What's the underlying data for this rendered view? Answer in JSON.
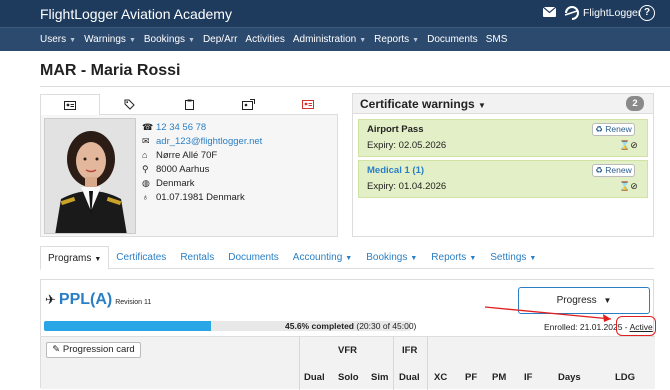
{
  "topbar": {
    "title": "FlightLogger Aviation Academy",
    "logo_text": "FlightLogger",
    "help_glyph": "?"
  },
  "nav": [
    {
      "label": "Users",
      "dropdown": true
    },
    {
      "label": "Warnings",
      "dropdown": true
    },
    {
      "label": "Bookings",
      "dropdown": true
    },
    {
      "label": "Dep/Arr",
      "dropdown": false
    },
    {
      "label": "Activities",
      "dropdown": false
    },
    {
      "label": "Administration",
      "dropdown": true
    },
    {
      "label": "Reports",
      "dropdown": true
    },
    {
      "label": "Documents",
      "dropdown": false
    },
    {
      "label": "SMS",
      "dropdown": false
    }
  ],
  "user": {
    "title": "MAR - Maria Rossi",
    "phone": "12 34 56 78",
    "email": "adr_123@flightlogger.net",
    "street": "Nørre Allé 70F",
    "city": "8000 Aarhus",
    "country": "Denmark",
    "birth": "01.07.1981 Denmark"
  },
  "profile_tabs": [
    "id-card-icon",
    "tags-icon",
    "clipboard-icon",
    "id-badge-icon",
    "red-id-card-icon"
  ],
  "cert_warnings": {
    "title": "Certificate warnings",
    "count": "2",
    "items": [
      {
        "name": "Airport Pass",
        "expiry": "Expiry: 02.05.2026",
        "renew": "Renew",
        "link": false
      },
      {
        "name": "Medical 1 (1)",
        "expiry": "Expiry: 01.04.2026",
        "renew": "Renew",
        "link": true
      }
    ]
  },
  "main_tabs": [
    {
      "label": "Programs",
      "dropdown": true,
      "active": true
    },
    {
      "label": "Certificates",
      "dropdown": false,
      "active": false
    },
    {
      "label": "Rentals",
      "dropdown": false,
      "active": false
    },
    {
      "label": "Documents",
      "dropdown": false,
      "active": false
    },
    {
      "label": "Accounting",
      "dropdown": true,
      "active": false
    },
    {
      "label": "Bookings",
      "dropdown": true,
      "active": false
    },
    {
      "label": "Reports",
      "dropdown": true,
      "active": false
    },
    {
      "label": "Settings",
      "dropdown": true,
      "active": false
    }
  ],
  "program": {
    "name": "PPL(A)",
    "revision": "Revision 11",
    "progress_button": "Progress",
    "progress_fraction": 0.456,
    "progress_percent": "45.6%",
    "progress_completed": "completed",
    "progress_detail": "(20:30 of 45:00)",
    "enrolled": "Enrolled: 21.01.2025 -",
    "status": "Active",
    "progression_card": "Progression card"
  },
  "table": {
    "groups": [
      "VFR",
      "IFR"
    ],
    "columns": [
      "Dual",
      "Solo",
      "Sim",
      "Dual",
      "XC",
      "PF",
      "PM",
      "IF",
      "Days",
      "LDG"
    ]
  },
  "colors": {
    "topbar": "#1e3b5e",
    "navbar": "#2c4a6e",
    "link": "#2a7fc4",
    "progress": "#29a6e6",
    "cert_bg": "#e3efc6",
    "annotation": "#e01f1f"
  }
}
